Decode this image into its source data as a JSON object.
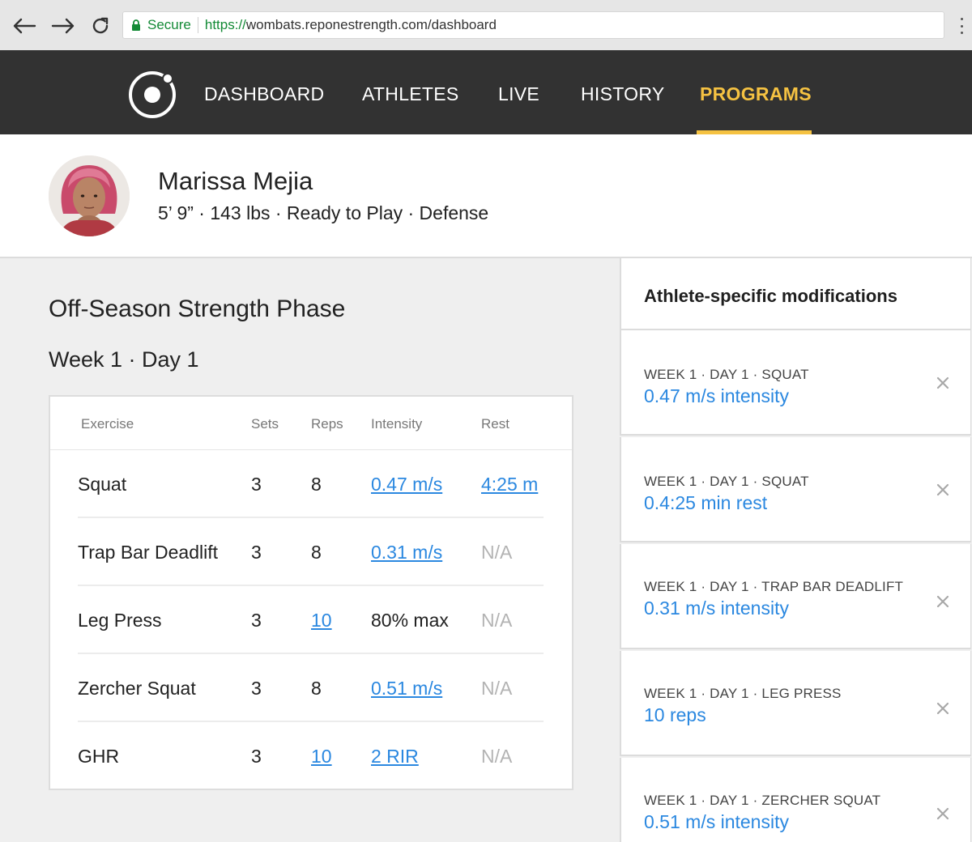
{
  "browser": {
    "secure_label": "Secure",
    "url_scheme": "https://",
    "url_rest": "wombats.reponestrength.com/dashboard"
  },
  "nav": {
    "items": [
      {
        "label": "DASHBOARD"
      },
      {
        "label": "ATHLETES"
      },
      {
        "label": "LIVE"
      },
      {
        "label": "HISTORY"
      },
      {
        "label": "PROGRAMS",
        "active": true
      }
    ],
    "active_color": "#f5c242"
  },
  "athlete": {
    "name": "Marissa Mejia",
    "details": "5’ 9” · 143 lbs · Ready to Play · Defense"
  },
  "program": {
    "title": "Off-Season Strength Phase",
    "day": "Week 1 · Day 1",
    "columns": [
      "Exercise",
      "Sets",
      "Reps",
      "Intensity",
      "Rest"
    ],
    "rows": [
      {
        "exercise": "Squat",
        "sets": "3",
        "reps": "8",
        "intensity": "0.47 m/s",
        "rest": "4:25 m"
      },
      {
        "exercise": "Trap Bar Deadlift",
        "sets": "3",
        "reps": "8",
        "intensity": "0.31 m/s",
        "rest": "N/A"
      },
      {
        "exercise": "Leg Press",
        "sets": "3",
        "reps": "10",
        "intensity": "80% max",
        "rest": "N/A"
      },
      {
        "exercise": "Zercher Squat",
        "sets": "3",
        "reps": "8",
        "intensity": "0.51 m/s",
        "rest": "N/A"
      },
      {
        "exercise": "GHR",
        "sets": "3",
        "reps": "10",
        "intensity": "2 RIR",
        "rest": "N/A"
      }
    ]
  },
  "modifications": {
    "title": "Athlete-specific modifications",
    "items": [
      {
        "label": "WEEK 1 · DAY 1 · SQUAT",
        "value": "0.47 m/s intensity"
      },
      {
        "label": "WEEK 1 · DAY 1 · SQUAT",
        "value": "0.4:25 min rest"
      },
      {
        "label": "WEEK 1 · DAY 1 · TRAP BAR DEADLIFT",
        "value": "0.31 m/s intensity"
      },
      {
        "label": "WEEK 1 · DAY 1 · LEG PRESS",
        "value": "10 reps"
      },
      {
        "label": "WEEK 1 · DAY 1 · ZERCHER SQUAT",
        "value": "0.51 m/s intensity"
      }
    ]
  },
  "colors": {
    "link": "#2b88e0",
    "nav_bg": "#323232",
    "secure": "#138a36"
  }
}
